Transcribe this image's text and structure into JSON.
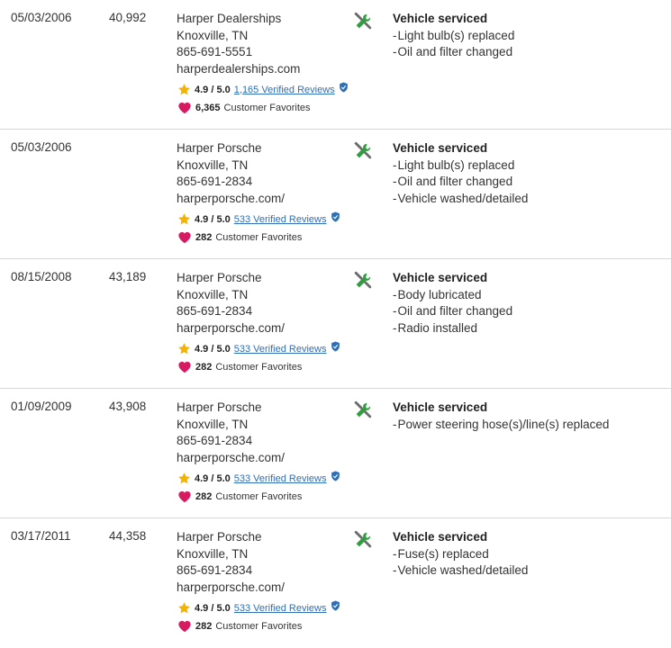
{
  "records": [
    {
      "date": "05/03/2006",
      "mileage": "40,992",
      "dealer_name": "Harper Dealerships",
      "city": "Knoxville, TN",
      "phone": "865-691-5551",
      "website": "harperdealerships.com",
      "rating": "4.9 / 5.0",
      "reviews": "1,165 Verified Reviews",
      "favorites": "6,365",
      "favorites_label": "Customer Favorites",
      "service_title": "Vehicle serviced",
      "service_items": [
        "Light bulb(s) replaced",
        "Oil and filter changed"
      ]
    },
    {
      "date": "05/03/2006",
      "mileage": "",
      "dealer_name": "Harper Porsche",
      "city": "Knoxville, TN",
      "phone": "865-691-2834",
      "website": "harperporsche.com/",
      "rating": "4.9 / 5.0",
      "reviews": "533 Verified Reviews",
      "favorites": "282",
      "favorites_label": "Customer Favorites",
      "service_title": "Vehicle serviced",
      "service_items": [
        "Light bulb(s) replaced",
        "Oil and filter changed",
        "Vehicle washed/detailed"
      ]
    },
    {
      "date": "08/15/2008",
      "mileage": "43,189",
      "dealer_name": "Harper Porsche",
      "city": "Knoxville, TN",
      "phone": "865-691-2834",
      "website": "harperporsche.com/",
      "rating": "4.9 / 5.0",
      "reviews": "533 Verified Reviews",
      "favorites": "282",
      "favorites_label": "Customer Favorites",
      "service_title": "Vehicle serviced",
      "service_items": [
        "Body lubricated",
        "Oil and filter changed",
        "Radio installed"
      ]
    },
    {
      "date": "01/09/2009",
      "mileage": "43,908",
      "dealer_name": "Harper Porsche",
      "city": "Knoxville, TN",
      "phone": "865-691-2834",
      "website": "harperporsche.com/",
      "rating": "4.9 / 5.0",
      "reviews": "533 Verified Reviews",
      "favorites": "282",
      "favorites_label": "Customer Favorites",
      "service_title": "Vehicle serviced",
      "service_items": [
        "Power steering hose(s)/line(s) replaced"
      ]
    },
    {
      "date": "03/17/2011",
      "mileage": "44,358",
      "dealer_name": "Harper Porsche",
      "city": "Knoxville, TN",
      "phone": "865-691-2834",
      "website": "harperporsche.com/",
      "rating": "4.9 / 5.0",
      "reviews": "533 Verified Reviews",
      "favorites": "282",
      "favorites_label": "Customer Favorites",
      "service_title": "Vehicle serviced",
      "service_items": [
        "Fuse(s) replaced",
        "Vehicle washed/detailed"
      ]
    }
  ],
  "icons": {
    "star": "star-icon",
    "heart": "heart-icon",
    "verified": "verified-shield-icon",
    "service": "wrench-screwdriver-icon"
  },
  "colors": {
    "star": "#f5b301",
    "heart": "#d81b60",
    "link": "#2f6fb5",
    "verified": "#2f6fb5",
    "tool_green": "#2e9e3e",
    "tool_gray": "#6b6b6b",
    "divider": "#d7d7d7"
  }
}
